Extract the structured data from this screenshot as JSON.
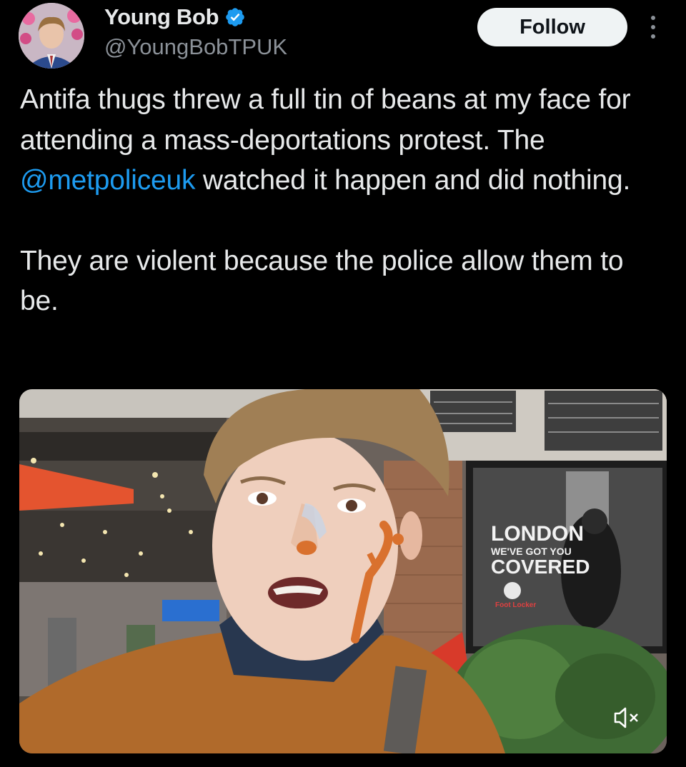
{
  "user": {
    "display_name": "Young Bob",
    "handle": "@YoungBobTPUK",
    "verified": true
  },
  "actions": {
    "follow_label": "Follow",
    "more_icon": "more-vertical-icon"
  },
  "tweet": {
    "line1_before": "Antifa thugs threw a full tin of beans at my face for attending a mass-deportations protest. The ",
    "mention": "@metpoliceuk",
    "line1_after": " watched it happen and did nothing.",
    "paragraph2": "They are violent because the police allow them to be."
  },
  "media": {
    "billboard_line1": "LONDON",
    "billboard_line2": "WE'VE GOT YOU",
    "billboard_line3": "COVERED",
    "billboard_brand": "Foot Locker",
    "mute_icon": "speaker-muted-icon"
  },
  "colors": {
    "background": "#000000",
    "text": "#e7e9ea",
    "secondary_text": "#8b9198",
    "link": "#1d9bf0",
    "verified": "#1d9bf0",
    "follow_bg": "#eff3f4"
  }
}
